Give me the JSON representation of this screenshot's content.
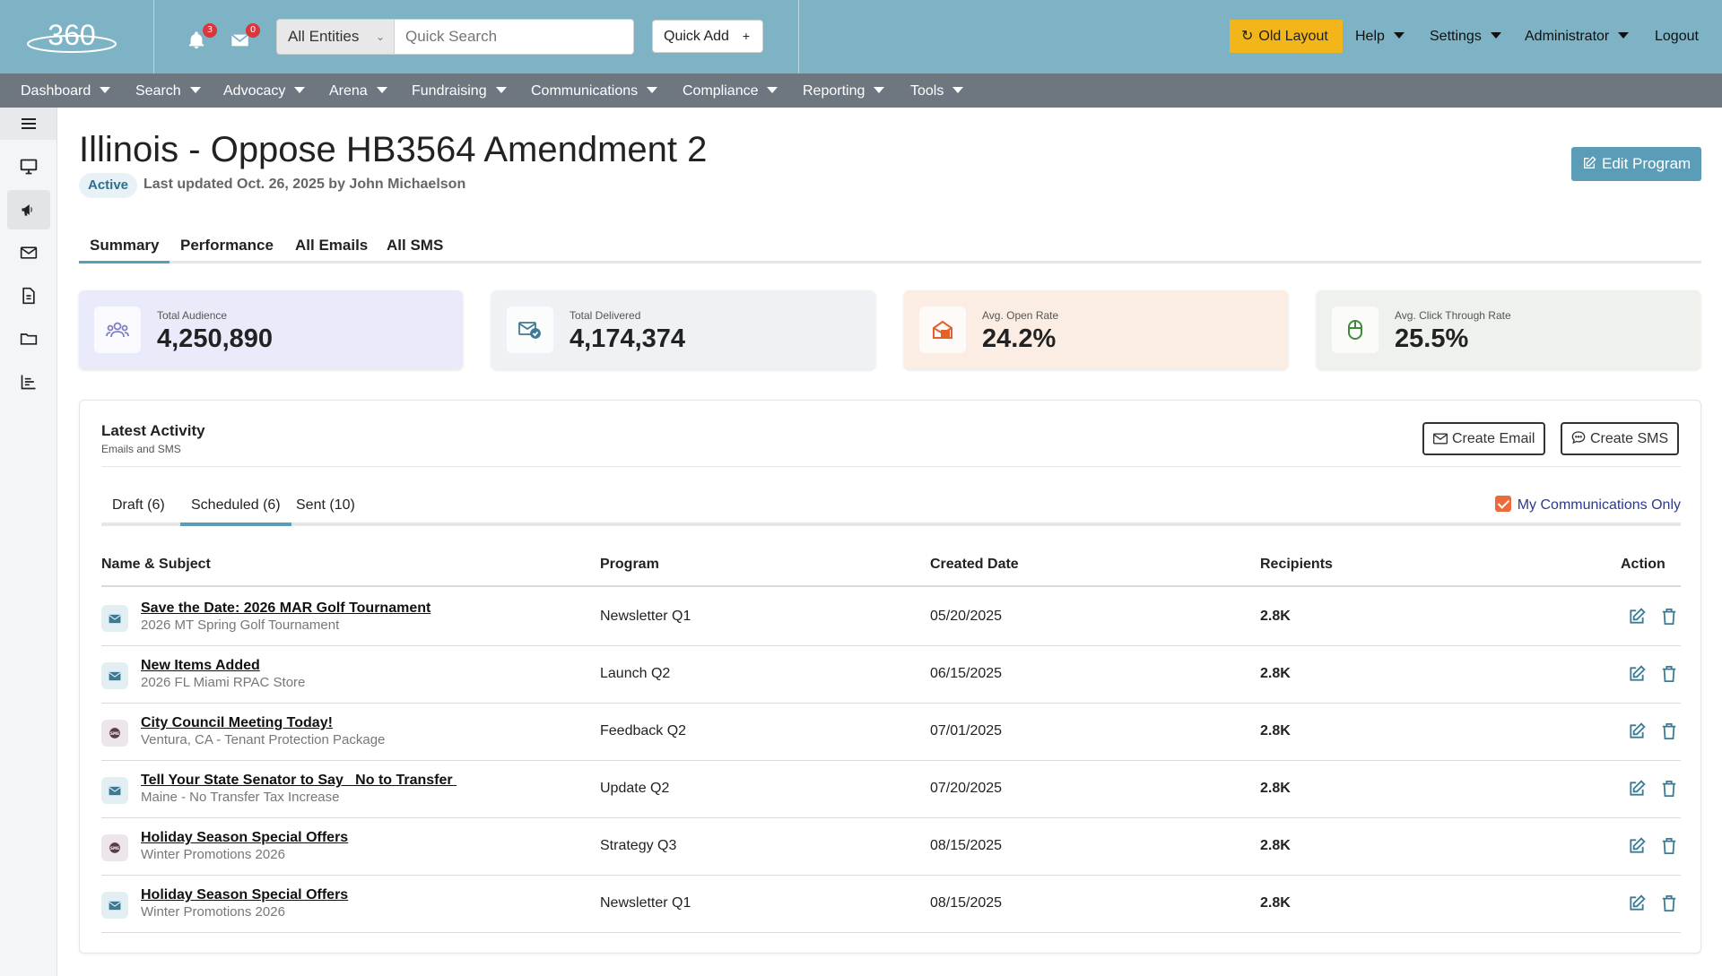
{
  "header": {
    "logo_text": "360",
    "notifications": {
      "icon": "bell-icon",
      "count": "3"
    },
    "messages": {
      "icon": "envelope-icon",
      "count": "0"
    },
    "entity_select": "All Entities",
    "search_placeholder": "Quick Search",
    "quick_add": "Quick Add",
    "old_layout": "Old Layout",
    "menu": {
      "help": "Help",
      "settings": "Settings",
      "admin": "Administrator",
      "logout": "Logout"
    }
  },
  "nav": [
    "Dashboard",
    "Search",
    "Advocacy",
    "Arena",
    "Fundraising",
    "Communications",
    "Compliance",
    "Reporting",
    "Tools"
  ],
  "sidebar": {
    "icons": [
      "menu-icon",
      "monitor-icon",
      "megaphone-icon",
      "envelope-icon",
      "document-icon",
      "folder-icon",
      "chart-icon"
    ],
    "active": "megaphone-icon"
  },
  "page": {
    "title": "Illinois - Oppose HB3564 Amendment 2",
    "status": "Active",
    "last_updated": "Last updated Oct. 26, 2025 by John Michaelson",
    "edit_button": "Edit Program"
  },
  "tabs": [
    "Summary",
    "Performance",
    "All Emails",
    "All SMS"
  ],
  "active_tab": "Summary",
  "stats": [
    {
      "label": "Total Audience",
      "value": "4,250,890",
      "icon": "users-icon",
      "bg": "#e9ebfa",
      "color": "#7d7fc4"
    },
    {
      "label": "Total Delivered",
      "value": "4,174,374",
      "icon": "mail-check-icon",
      "bg": "#eef2f4",
      "color": "#3f7a94"
    },
    {
      "label": "Avg. Open Rate",
      "value": "24.2%",
      "icon": "open-envelope-icon",
      "bg": "#fbece4",
      "color": "#e2622b"
    },
    {
      "label": "Avg. Click Through Rate",
      "value": "25.5%",
      "icon": "mouse-icon",
      "bg": "#eef1ec",
      "color": "#3e8a3a"
    }
  ],
  "activity": {
    "title": "Latest Activity",
    "subtitle": "Emails and SMS",
    "create_email": "Create Email",
    "create_sms": "Create SMS",
    "subtabs": [
      "Draft (6)",
      "Scheduled (6)",
      "Sent (10)"
    ],
    "active_subtab": "Scheduled (6)",
    "my_communications": "My Communications Only",
    "columns": {
      "name": "Name & Subject",
      "program": "Program",
      "created": "Created Date",
      "recipients": "Recipients",
      "action": "Action"
    },
    "rows": [
      {
        "type": "email",
        "name": "Save the Date: 2026 MAR Golf Tournament",
        "subject": "2026 MT Spring Golf Tournament",
        "program": "Newsletter Q1",
        "created": "05/20/2025",
        "recipients": "2.8K"
      },
      {
        "type": "email",
        "name": "New Items Added",
        "subject": "2026 FL Miami RPAC Store",
        "program": "Launch Q2",
        "created": "06/15/2025",
        "recipients": "2.8K"
      },
      {
        "type": "sms",
        "name": "City Council Meeting Today!",
        "subject": "Ventura, CA - Tenant Protection Package",
        "program": "Feedback Q2",
        "created": "07/01/2025",
        "recipients": "2.8K"
      },
      {
        "type": "email",
        "name": "Tell Your State Senator to Say   No to Transfer ",
        "subject": "Maine - No Transfer Tax Increase",
        "program": "Update Q2",
        "created": "07/20/2025",
        "recipients": "2.8K"
      },
      {
        "type": "sms",
        "name": "Holiday Season Special Offers",
        "subject": "Winter Promotions 2026",
        "program": "Strategy Q3",
        "created": "08/15/2025",
        "recipients": "2.8K"
      },
      {
        "type": "email",
        "name": "Holiday Season Special Offers",
        "subject": "Winter Promotions 2026",
        "program": "Newsletter Q1",
        "created": "08/15/2025",
        "recipients": "2.8K"
      }
    ]
  }
}
